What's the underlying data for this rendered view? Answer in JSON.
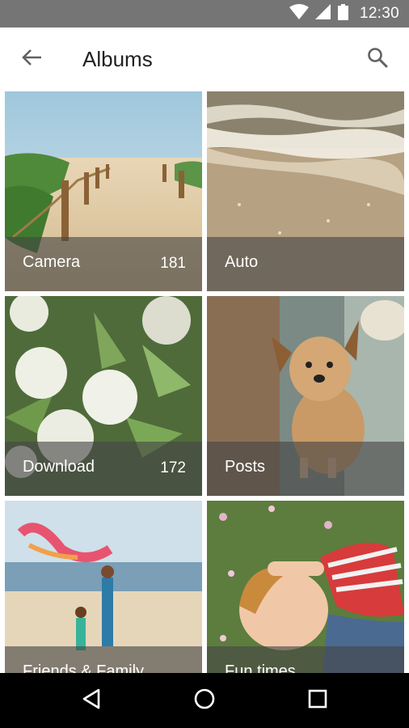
{
  "status_bar": {
    "time": "12:30",
    "icons": [
      "wifi-icon",
      "signal-icon",
      "battery-icon"
    ]
  },
  "app_bar": {
    "title": "Albums",
    "back_icon": "arrow-back-icon",
    "search_icon": "search-icon"
  },
  "albums": [
    {
      "name": "Camera",
      "count": "181",
      "photo": "beach-boardwalk"
    },
    {
      "name": "Auto",
      "count": "",
      "photo": "ocean-waves-sand"
    },
    {
      "name": "Download",
      "count": "172",
      "photo": "white-flowers"
    },
    {
      "name": "Posts",
      "count": "",
      "photo": "small-dog"
    },
    {
      "name": "Friends & Family",
      "count": "",
      "photo": "mother-child-beach"
    },
    {
      "name": "Fun times",
      "count": "",
      "photo": "child-in-grass"
    }
  ],
  "nav_bar": {
    "icons": [
      "back-triangle-icon",
      "home-circle-icon",
      "recents-square-icon"
    ]
  },
  "colors": {
    "status_bar": "#757575",
    "caption_overlay": "rgba(70,70,70,0.62)",
    "nav_bar": "#000000"
  }
}
